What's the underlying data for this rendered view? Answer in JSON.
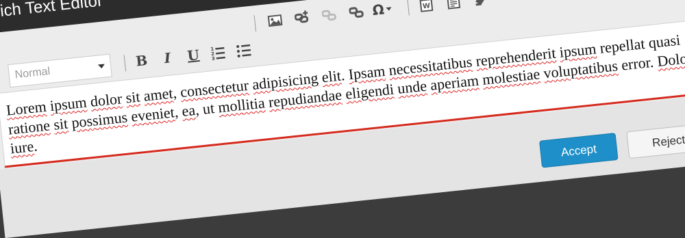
{
  "window": {
    "title": "Rich Text Editor"
  },
  "toolbar": {
    "format_value": "Normal",
    "bold_label": "B",
    "italic_label": "I",
    "underline_label": "U",
    "special_char_label": "Ω"
  },
  "editor": {
    "segments": [
      {
        "t": "Lorem",
        "s": true
      },
      {
        "t": " ",
        "s": false
      },
      {
        "t": "ipsum",
        "s": true
      },
      {
        "t": " ",
        "s": false
      },
      {
        "t": "dolor",
        "s": true
      },
      {
        "t": " ",
        "s": false
      },
      {
        "t": "sit",
        "s": true
      },
      {
        "t": " ",
        "s": false
      },
      {
        "t": "amet",
        "s": true
      },
      {
        "t": ", ",
        "s": false
      },
      {
        "t": "consectetur",
        "s": true
      },
      {
        "t": " ",
        "s": false
      },
      {
        "t": "adipisicing",
        "s": true
      },
      {
        "t": " ",
        "s": false
      },
      {
        "t": "elit",
        "s": true
      },
      {
        "t": ". ",
        "s": false
      },
      {
        "t": "Ipsam",
        "s": true
      },
      {
        "t": " ",
        "s": false
      },
      {
        "t": "necessitatibus",
        "s": true
      },
      {
        "t": " ",
        "s": false
      },
      {
        "t": "reprehenderit",
        "s": true
      },
      {
        "t": " ",
        "s": false
      },
      {
        "t": "ipsum",
        "s": true
      },
      {
        "t": " ",
        "s": false
      },
      {
        "t": "repellat",
        "s": false
      },
      {
        "t": " quasi ",
        "s": false
      },
      {
        "t": "ratione",
        "s": true
      },
      {
        "t": " ",
        "s": false
      },
      {
        "t": "sit",
        "s": true
      },
      {
        "t": " ",
        "s": false
      },
      {
        "t": "possimus",
        "s": true
      },
      {
        "t": " ",
        "s": false
      },
      {
        "t": "eveniet",
        "s": true
      },
      {
        "t": ", ",
        "s": false
      },
      {
        "t": "ea",
        "s": true
      },
      {
        "t": ", ut ",
        "s": false
      },
      {
        "t": "mollitia",
        "s": true
      },
      {
        "t": " ",
        "s": false
      },
      {
        "t": "repudiandae",
        "s": true
      },
      {
        "t": " ",
        "s": false
      },
      {
        "t": "eligendi",
        "s": true
      },
      {
        "t": " ",
        "s": false
      },
      {
        "t": "unde",
        "s": true
      },
      {
        "t": " ",
        "s": false
      },
      {
        "t": "aperiam",
        "s": true
      },
      {
        "t": " ",
        "s": false
      },
      {
        "t": "molestiae",
        "s": true
      },
      {
        "t": " ",
        "s": false
      },
      {
        "t": "voluptatibus",
        "s": true
      },
      {
        "t": " error. ",
        "s": false
      },
      {
        "t": "Dolorem",
        "s": true
      },
      {
        "t": ", ",
        "s": false
      },
      {
        "t": "iure",
        "s": true
      },
      {
        "t": ".",
        "s": false
      }
    ]
  },
  "footer": {
    "accept_label": "Accept",
    "reject_label": "Reject"
  },
  "colors": {
    "accent": "#1e8fc8",
    "spellcheck": "#e02020",
    "editor_border": "#d52b1e"
  }
}
